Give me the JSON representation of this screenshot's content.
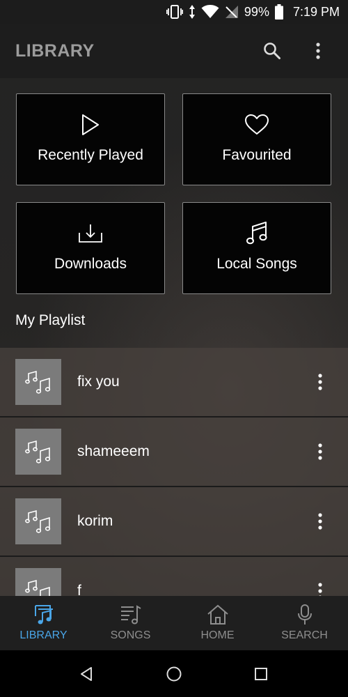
{
  "status": {
    "battery": "99%",
    "time": "7:19 PM"
  },
  "appbar": {
    "title": "LIBRARY",
    "search_icon": "search-icon",
    "more_icon": "more-vert-icon"
  },
  "tiles": [
    {
      "label": "Recently Played",
      "icon": "play-icon"
    },
    {
      "label": "Favourited",
      "icon": "heart-icon"
    },
    {
      "label": "Downloads",
      "icon": "download-icon"
    },
    {
      "label": "Local Songs",
      "icon": "music-note-icon"
    }
  ],
  "playlist_section": {
    "title": "My Playlist"
  },
  "playlists": [
    {
      "name": "fix you"
    },
    {
      "name": "shameeem"
    },
    {
      "name": "korim"
    },
    {
      "name": "f"
    }
  ],
  "bottom_nav": [
    {
      "label": "LIBRARY",
      "icon": "library-icon",
      "active": true
    },
    {
      "label": "SONGS",
      "icon": "songs-icon",
      "active": false
    },
    {
      "label": "HOME",
      "icon": "home-icon",
      "active": false
    },
    {
      "label": "SEARCH",
      "icon": "mic-icon",
      "active": false
    }
  ],
  "colors": {
    "accent": "#4aa6e8",
    "inactive": "#8e8e8e"
  }
}
